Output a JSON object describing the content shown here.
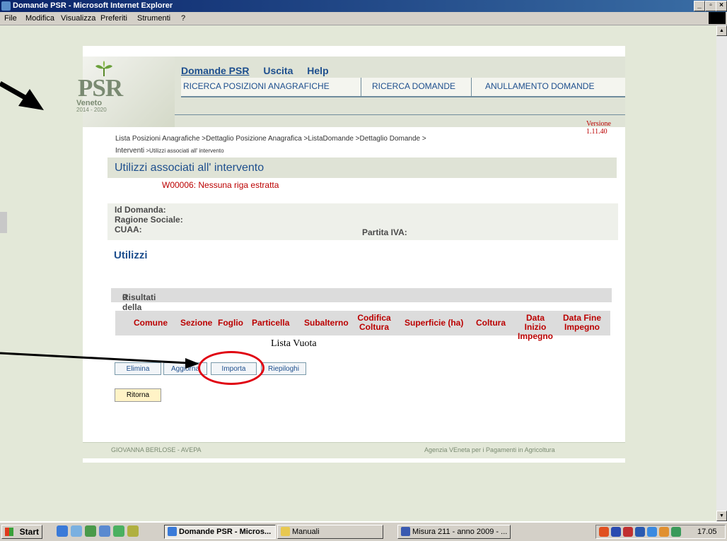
{
  "window": {
    "title": "Domande PSR - Microsoft Internet Explorer",
    "controls": {
      "minimize": "_",
      "maximize": "°",
      "close": "x"
    }
  },
  "menubar": [
    "File",
    "Modifica",
    "Visualizza",
    "Preferiti",
    "Strumenti",
    "?"
  ],
  "logo": {
    "word": "PSR",
    "region": "Veneto",
    "years": "2014 - 2020"
  },
  "topnav": [
    "Domande PSR",
    "Uscita",
    "Help"
  ],
  "tabs": [
    "RICERCA POSIZIONI ANAGRAFICHE",
    "RICERCA DOMANDE",
    "ANULLAMENTO DOMANDE"
  ],
  "version": "Versione 1.11.40",
  "breadcrumb": {
    "line1": "Lista Posizioni Anagrafiche >Dettaglio Posizione Anagrafica >ListaDomande >Dettaglio Domande >",
    "line2_a": "Interventi",
    "line2_b": " >Utilizzi associati all' intervento"
  },
  "page_title": "Utilizzi associati all' intervento",
  "error_message": "W00006: Nessuna riga estratta",
  "info_labels": {
    "id_domanda": "Id Domanda:",
    "ragione_sociale": "Ragione Sociale:",
    "cuaa": "CUAA:",
    "partita_iva": "Partita IVA:"
  },
  "section_title": "Utilizzi",
  "results": {
    "label": "Risultati della ricerca:",
    "count": "0"
  },
  "table_headers": [
    "Comune",
    "Sezione",
    "Foglio",
    "Particella",
    "Subalterno",
    "Codifica Coltura",
    "Superficie (ha)",
    "Coltura",
    "Data Inizio Impegno",
    "Data Fine Impegno"
  ],
  "empty_list": "Lista Vuota",
  "buttons": {
    "elimina": "Elimina",
    "aggiorna": "Aggiorna",
    "importa": "Importa",
    "riepiloghi": "Riepiloghi",
    "ritorna": "Ritorna"
  },
  "footer": {
    "left": "GIOVANNA BERLOSE - AVEPA",
    "right": "Agenzia VEneta per i Pagamenti in Agricoltura"
  },
  "taskbar": {
    "start": "Start",
    "items": [
      "Domande PSR - Micros...",
      "Manuali",
      "Misura 211 - anno 2009 - ..."
    ],
    "clock": "17.05"
  },
  "annotation": {
    "arrow_color": "#000000",
    "circle_color": "#e00010"
  }
}
